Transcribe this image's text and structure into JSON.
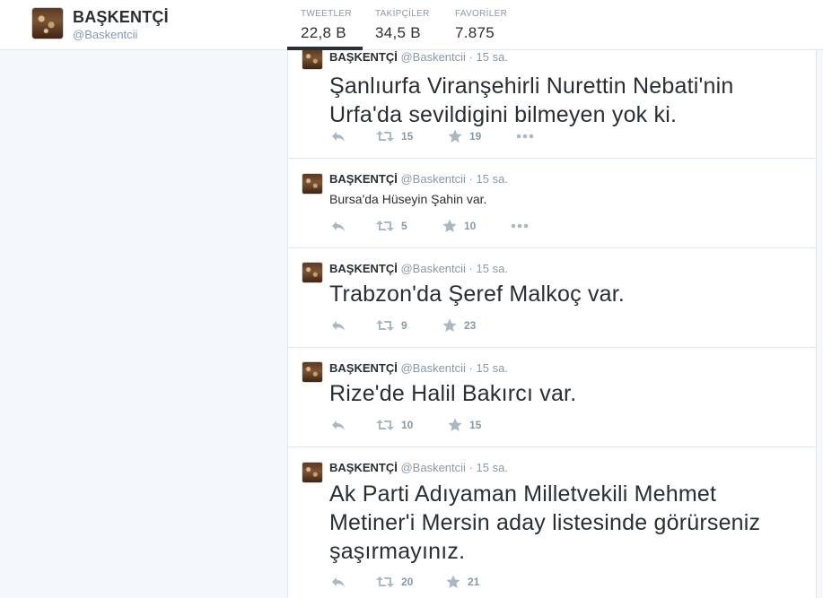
{
  "profile": {
    "name": "BAŞKENTÇİ",
    "handle": "@Baskentcii"
  },
  "stats": [
    {
      "label": "TWEETLER",
      "value": "22,8 B",
      "active": true
    },
    {
      "label": "TAKİPÇİLER",
      "value": "34,5 B",
      "active": false
    },
    {
      "label": "FAVORİLER",
      "value": "7.875",
      "active": false
    }
  ],
  "tweets": [
    {
      "author": "BAŞKENTÇİ",
      "handle": "@Baskentcii",
      "time": "15 sa.",
      "text": "Şanlıurfa Viranşehirli Nurettin Nebati'nin Urfa'da sevildigini bilmeyen yok ki.",
      "retweets": "15",
      "favorites": "19"
    },
    {
      "author": "BAŞKENTÇİ",
      "handle": "@Baskentcii",
      "time": "15 sa.",
      "text": "Bursa'da Hüseyin Şahin var.",
      "retweets": "5",
      "favorites": "10"
    },
    {
      "author": "BAŞKENTÇİ",
      "handle": "@Baskentcii",
      "time": "15 sa.",
      "text": "Trabzon'da Şeref Malkoç var.",
      "retweets": "9",
      "favorites": "23"
    },
    {
      "author": "BAŞKENTÇİ",
      "handle": "@Baskentcii",
      "time": "15 sa.",
      "text": "Rize'de Halil Bakırcı var.",
      "retweets": "10",
      "favorites": "15"
    },
    {
      "author": "BAŞKENTÇİ",
      "handle": "@Baskentcii",
      "time": "15 sa.",
      "text": "Ak Parti Adıyaman Milletvekili Mehmet Metiner'i Mersin aday listesinde görürseniz şaşırmayınız.",
      "retweets": "20",
      "favorites": "21"
    }
  ],
  "separator": "·",
  "icons": {
    "reply": "reply-icon",
    "retweet": "retweet-icon",
    "favorite": "star-icon",
    "more": "more-icon"
  },
  "colors": {
    "text": "#292f33",
    "muted": "#8899a6",
    "border": "#e1e8ed",
    "background": "#f5f8fa"
  }
}
